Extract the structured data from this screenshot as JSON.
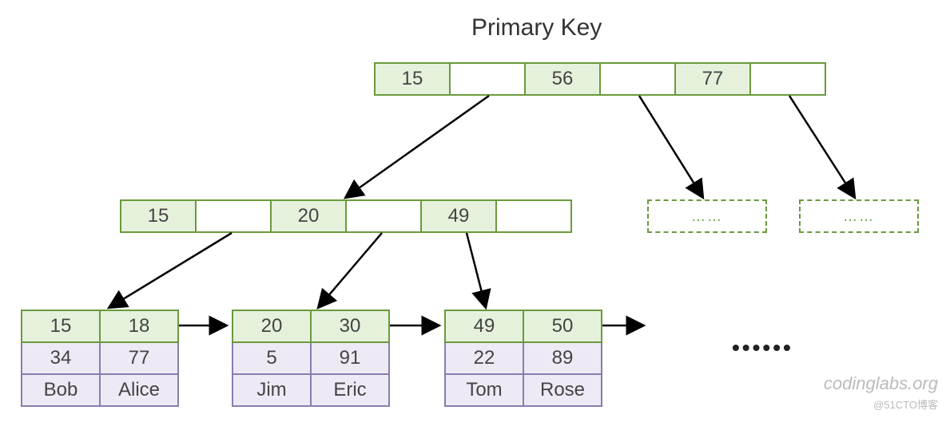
{
  "title": "Primary Key",
  "root": {
    "keys": [
      "15",
      "56",
      "77"
    ]
  },
  "internal": {
    "keys": [
      "15",
      "20",
      "49"
    ]
  },
  "leaf_nodes": [
    {
      "keys": [
        "15",
        "18"
      ],
      "data": [
        [
          "34",
          "77"
        ],
        [
          "Bob",
          "Alice"
        ]
      ]
    },
    {
      "keys": [
        "20",
        "30"
      ],
      "data": [
        [
          "5",
          "91"
        ],
        [
          "Jim",
          "Eric"
        ]
      ]
    },
    {
      "keys": [
        "49",
        "50"
      ],
      "data": [
        [
          "22",
          "89"
        ],
        [
          "Tom",
          "Rose"
        ]
      ]
    }
  ],
  "dashed_placeholder": "……",
  "ellipsis": "••••••",
  "watermark1": "codinglabs.org",
  "watermark2": "@51CTO博客",
  "chart_data": {
    "type": "tree",
    "description": "B+ tree clustered index on primary key",
    "root_keys": [
      15,
      56,
      77
    ],
    "internal_keys": [
      15,
      20,
      49
    ],
    "leaves": [
      {
        "pk": 15,
        "col2": 34,
        "name": "Bob"
      },
      {
        "pk": 18,
        "col2": 77,
        "name": "Alice"
      },
      {
        "pk": 20,
        "col2": 5,
        "name": "Jim"
      },
      {
        "pk": 30,
        "col2": 91,
        "name": "Eric"
      },
      {
        "pk": 49,
        "col2": 22,
        "name": "Tom"
      },
      {
        "pk": 50,
        "col2": 89,
        "name": "Rose"
      }
    ]
  }
}
